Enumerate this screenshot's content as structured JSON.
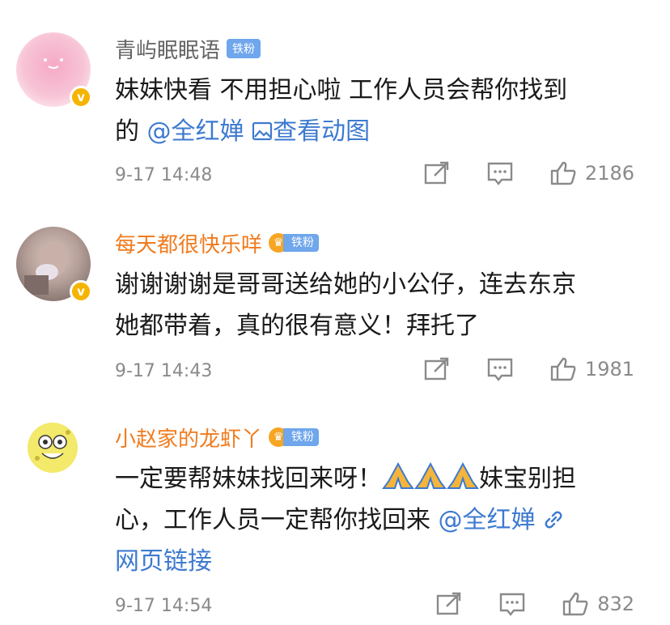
{
  "comments": [
    {
      "username": "青屿眠眠语",
      "badge": "铁粉",
      "text_line1": "妹妹快看 不用担心啦 工作人员会帮你找到",
      "text_line2_prefix": "的 ",
      "mention": "@全红婵",
      "link_text": "查看动图",
      "time": "9-17 14:48",
      "likes": "2186"
    },
    {
      "username": "每天都很快乐咩",
      "badge": "铁粉",
      "text_line1": "谢谢谢谢是哥哥送给她的小公仔，连去东京",
      "text_line2": "她都带着，真的很有意义！拜托了",
      "time": "9-17 14:43",
      "likes": "1981"
    },
    {
      "username": "小赵家的龙虾丫",
      "badge": "铁粉",
      "text_line1_prefix": "一定要帮妹妹找回来呀！",
      "text_line1_suffix": "妹宝别担",
      "text_line2_prefix": "心，工作人员一定帮你找回来 ",
      "mention": "@全红婵",
      "link_text": "网页链接",
      "time": "9-17 14:54",
      "likes": "832"
    }
  ],
  "colors": {
    "link": "#3d7ad0",
    "username_orange": "#f07b1e",
    "fan_badge": "#6fa6ec",
    "verified": "#f5b400"
  }
}
